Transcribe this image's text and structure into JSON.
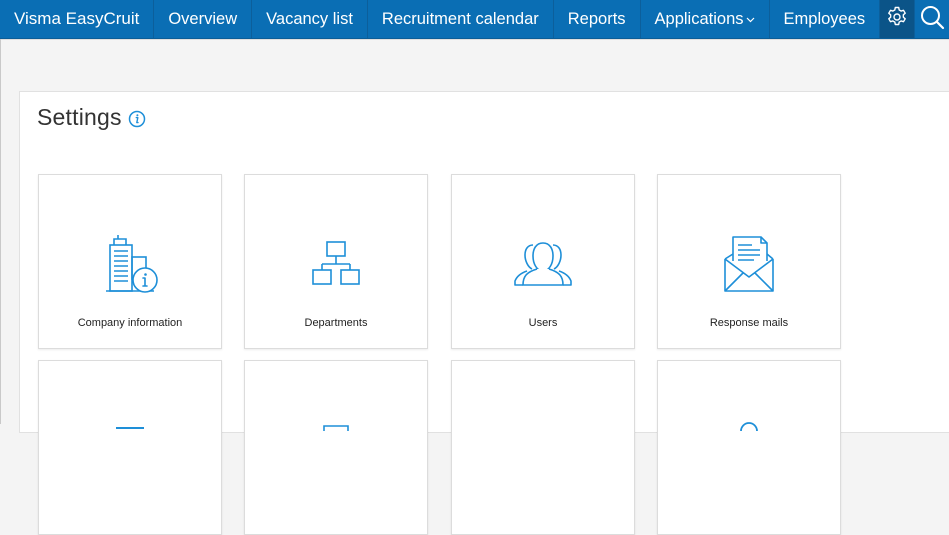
{
  "colors": {
    "nav_bg": "#0a6eb4",
    "nav_active_bg": "#0b5488",
    "accent_icon": "#1e8fd8",
    "page_bg": "#f4f4f4"
  },
  "nav": {
    "brand": "Visma EasyCruit",
    "items": [
      {
        "label": "Overview"
      },
      {
        "label": "Vacancy list"
      },
      {
        "label": "Recruitment calendar"
      },
      {
        "label": "Reports"
      },
      {
        "label": "Applications",
        "has_dropdown": true
      },
      {
        "label": "Employees"
      }
    ],
    "settings_icon": "gear-icon",
    "search_icon": "search-icon"
  },
  "settings": {
    "title": "Settings",
    "info_icon": "info-icon",
    "tiles": [
      {
        "label": "Company information",
        "icon": "building-info-icon"
      },
      {
        "label": "Departments",
        "icon": "org-chart-icon"
      },
      {
        "label": "Users",
        "icon": "users-group-icon"
      },
      {
        "label": "Response mails",
        "icon": "envelope-letter-icon"
      }
    ]
  }
}
